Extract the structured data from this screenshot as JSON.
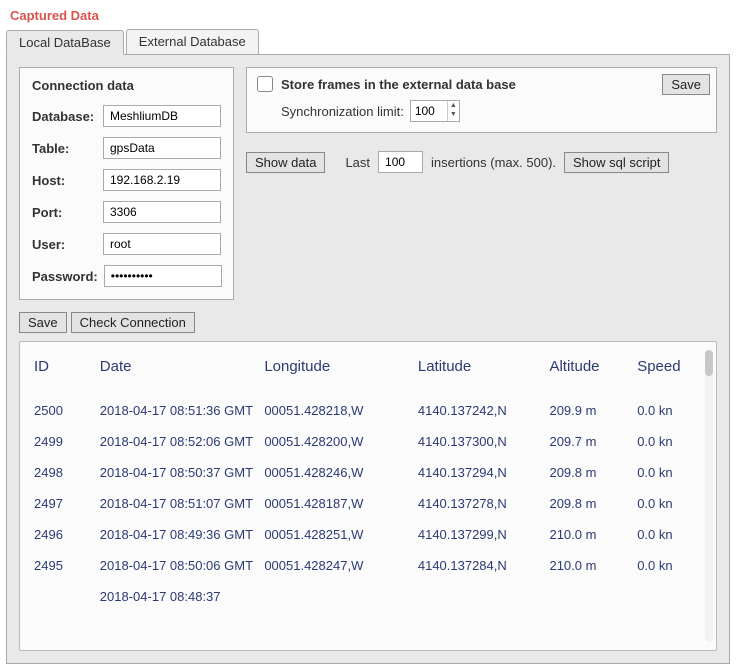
{
  "title": "Captured Data",
  "tabs": [
    "Local DataBase",
    "External Database"
  ],
  "activeTab": 0,
  "connection": {
    "heading": "Connection data",
    "labels": {
      "database": "Database:",
      "table": "Table:",
      "host": "Host:",
      "port": "Port:",
      "user": "User:",
      "password": "Password:"
    },
    "values": {
      "database": "MeshliumDB",
      "table": "gpsData",
      "host": "192.168.2.19",
      "port": "3306",
      "user": "root",
      "password": "••••••••••"
    }
  },
  "storeBox": {
    "checkboxLabel": "Store frames in the external data base",
    "syncLabel": "Synchronization limit:",
    "syncValue": "100",
    "saveLabel": "Save"
  },
  "queryRow": {
    "showData": "Show data",
    "lastLabel": "Last",
    "lastValue": "100",
    "insertions": "insertions (max. 500).",
    "showSql": "Show sql script"
  },
  "bottomButtons": {
    "save": "Save",
    "check": "Check Connection"
  },
  "table": {
    "headers": [
      "ID",
      "Date",
      "Longitude",
      "Latitude",
      "Altitude",
      "Speed"
    ],
    "rows": [
      {
        "id": "2500",
        "date": "2018-04-17 08:51:36 GMT",
        "lon": "00051.428218,W",
        "lat": "4140.137242,N",
        "alt": "209.9 m",
        "spd": "0.0 kn"
      },
      {
        "id": "2499",
        "date": "2018-04-17 08:52:06 GMT",
        "lon": "00051.428200,W",
        "lat": "4140.137300,N",
        "alt": "209.7 m",
        "spd": "0.0 kn"
      },
      {
        "id": "2498",
        "date": "2018-04-17 08:50:37 GMT",
        "lon": "00051.428246,W",
        "lat": "4140.137294,N",
        "alt": "209.8 m",
        "spd": "0.0 kn"
      },
      {
        "id": "2497",
        "date": "2018-04-17 08:51:07 GMT",
        "lon": "00051.428187,W",
        "lat": "4140.137278,N",
        "alt": "209.8 m",
        "spd": "0.0 kn"
      },
      {
        "id": "2496",
        "date": "2018-04-17 08:49:36 GMT",
        "lon": "00051.428251,W",
        "lat": "4140.137299,N",
        "alt": "210.0 m",
        "spd": "0.0 kn"
      },
      {
        "id": "2495",
        "date": "2018-04-17 08:50:06 GMT",
        "lon": "00051.428247,W",
        "lat": "4140.137284,N",
        "alt": "210.0 m",
        "spd": "0.0 kn"
      },
      {
        "id": "",
        "date": "2018-04-17 08:48:37",
        "lon": "",
        "lat": "",
        "alt": "",
        "spd": ""
      }
    ]
  }
}
